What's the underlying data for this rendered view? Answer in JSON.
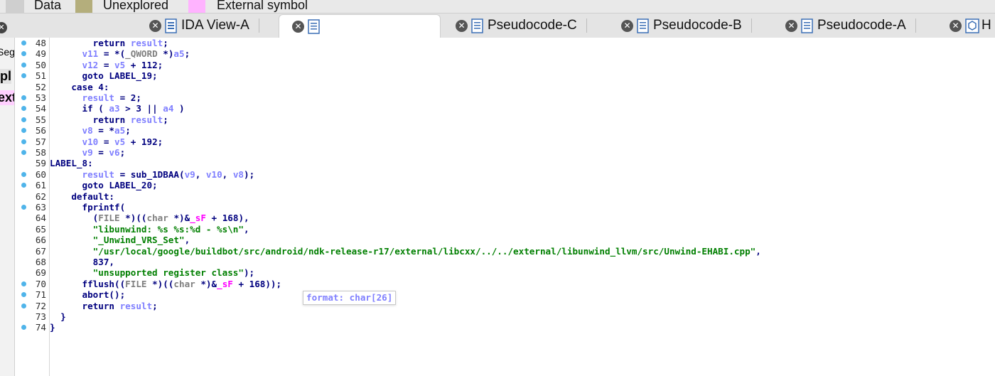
{
  "legend": {
    "items": [
      {
        "label": "Data",
        "color": "#cfcfcf"
      },
      {
        "label": "Unexplored",
        "color": "#b4ae7c"
      },
      {
        "label": "External symbol",
        "color": "#ffb3ff"
      }
    ]
  },
  "tabs": [
    {
      "label": "IDA View-A",
      "icon": "ida-view-icon",
      "active": false
    },
    {
      "label": "",
      "icon": "document-icon",
      "active": true
    },
    {
      "label": "Pseudocode-C",
      "icon": "document-icon",
      "active": false
    },
    {
      "label": "Pseudocode-B",
      "icon": "document-icon",
      "active": false
    },
    {
      "label": "Pseudocode-A",
      "icon": "document-icon",
      "active": false
    },
    {
      "label": "H",
      "icon": "hex-view-icon",
      "active": false
    }
  ],
  "sidebar_fragments": [
    "Seg",
    "pl",
    "ext"
  ],
  "code_lines": [
    {
      "num": "48",
      "dot": true,
      "segs": [
        [
          "kw",
          "        return "
        ],
        [
          "var",
          "result"
        ],
        [
          "kw",
          ";"
        ]
      ]
    },
    {
      "num": "49",
      "dot": true,
      "segs": [
        [
          "var",
          "      v11"
        ],
        [
          "kw",
          " = *("
        ],
        [
          "mac",
          "_QWORD"
        ],
        [
          "kw",
          " *)"
        ],
        [
          "var",
          "a5"
        ],
        [
          "kw",
          ";"
        ]
      ]
    },
    {
      "num": "50",
      "dot": true,
      "segs": [
        [
          "var",
          "      v12"
        ],
        [
          "kw",
          " = "
        ],
        [
          "var",
          "v5"
        ],
        [
          "kw",
          " + 112;"
        ]
      ]
    },
    {
      "num": "51",
      "dot": true,
      "segs": [
        [
          "kw",
          "      goto LABEL_19;"
        ]
      ]
    },
    {
      "num": "52",
      "dot": false,
      "segs": [
        [
          "kw",
          "    case 4:"
        ]
      ]
    },
    {
      "num": "53",
      "dot": true,
      "segs": [
        [
          "var",
          "      result"
        ],
        [
          "kw",
          " = 2;"
        ]
      ]
    },
    {
      "num": "54",
      "dot": true,
      "segs": [
        [
          "kw",
          "      if ( "
        ],
        [
          "var",
          "a3"
        ],
        [
          "kw",
          " > 3 || "
        ],
        [
          "var",
          "a4"
        ],
        [
          "kw",
          " )"
        ]
      ]
    },
    {
      "num": "55",
      "dot": true,
      "segs": [
        [
          "kw",
          "        return "
        ],
        [
          "var",
          "result"
        ],
        [
          "kw",
          ";"
        ]
      ]
    },
    {
      "num": "56",
      "dot": true,
      "segs": [
        [
          "var",
          "      v8"
        ],
        [
          "kw",
          " = *"
        ],
        [
          "var",
          "a5"
        ],
        [
          "kw",
          ";"
        ]
      ]
    },
    {
      "num": "57",
      "dot": true,
      "segs": [
        [
          "var",
          "      v10"
        ],
        [
          "kw",
          " = "
        ],
        [
          "var",
          "v5"
        ],
        [
          "kw",
          " + 192;"
        ]
      ]
    },
    {
      "num": "58",
      "dot": true,
      "segs": [
        [
          "var",
          "      v9"
        ],
        [
          "kw",
          " = "
        ],
        [
          "var",
          "v6"
        ],
        [
          "kw",
          ";"
        ]
      ]
    },
    {
      "num": "59",
      "dot": false,
      "segs": [
        [
          "kw",
          "LABEL_8:"
        ]
      ]
    },
    {
      "num": "60",
      "dot": true,
      "segs": [
        [
          "var",
          "      result"
        ],
        [
          "kw",
          " = sub_1DBAA("
        ],
        [
          "var",
          "v9"
        ],
        [
          "kw",
          ", "
        ],
        [
          "var",
          "v10"
        ],
        [
          "kw",
          ", "
        ],
        [
          "var",
          "v8"
        ],
        [
          "kw",
          ");"
        ]
      ]
    },
    {
      "num": "61",
      "dot": true,
      "segs": [
        [
          "kw",
          "      goto LABEL_20;"
        ]
      ]
    },
    {
      "num": "62",
      "dot": false,
      "segs": [
        [
          "kw",
          "    default:"
        ]
      ]
    },
    {
      "num": "63",
      "dot": true,
      "segs": [
        [
          "kw",
          "      fprintf("
        ]
      ]
    },
    {
      "num": "64",
      "dot": false,
      "segs": [
        [
          "kw",
          "        ("
        ],
        [
          "type",
          "FILE"
        ],
        [
          "kw",
          " *)(("
        ],
        [
          "type",
          "char"
        ],
        [
          "kw",
          " *)&"
        ],
        [
          "imp",
          "_sF"
        ],
        [
          "kw",
          " + 168),"
        ]
      ]
    },
    {
      "num": "65",
      "dot": false,
      "segs": [
        [
          "str",
          "        \"libunwind: %s %s:%d - %s\\n\""
        ],
        [
          "kw",
          ","
        ]
      ]
    },
    {
      "num": "66",
      "dot": false,
      "segs": [
        [
          "str",
          "        \"_Unwind_VRS_Set\""
        ],
        [
          "kw",
          ","
        ]
      ]
    },
    {
      "num": "67",
      "dot": false,
      "segs": [
        [
          "str",
          "        \"/usr/local/google/buildbot/src/android/ndk-release-r17/external/libcxx/../../external/libunwind_llvm/src/Unwind-EHABI.cpp\""
        ],
        [
          "kw",
          ","
        ]
      ]
    },
    {
      "num": "68",
      "dot": false,
      "segs": [
        [
          "kw",
          "        837,"
        ]
      ]
    },
    {
      "num": "69",
      "dot": false,
      "segs": [
        [
          "str",
          "        \"unsupported register class\""
        ],
        [
          "kw",
          ");"
        ]
      ]
    },
    {
      "num": "70",
      "dot": true,
      "segs": [
        [
          "kw",
          "      fflush(("
        ],
        [
          "type",
          "FILE"
        ],
        [
          "kw",
          " *)(("
        ],
        [
          "type",
          "char"
        ],
        [
          "kw",
          " *)&"
        ],
        [
          "imp",
          "_sF"
        ],
        [
          "kw",
          " + 168));"
        ]
      ]
    },
    {
      "num": "71",
      "dot": true,
      "segs": [
        [
          "kw",
          "      abort();"
        ]
      ]
    },
    {
      "num": "72",
      "dot": true,
      "segs": [
        [
          "kw",
          "      return "
        ],
        [
          "var",
          "result"
        ],
        [
          "kw",
          ";"
        ]
      ]
    },
    {
      "num": "73",
      "dot": false,
      "segs": [
        [
          "kw",
          "  }"
        ]
      ]
    },
    {
      "num": "74",
      "dot": true,
      "segs": [
        [
          "kw",
          "}"
        ]
      ]
    }
  ],
  "tooltip": "format: char[26]",
  "colors": {
    "keyword": "#00007f",
    "variable": "#7f7fff",
    "string": "#007f00",
    "import": "#ff00ff",
    "macro": "#7f7f7f",
    "breakpoint_dot": "#4fb4ea"
  }
}
